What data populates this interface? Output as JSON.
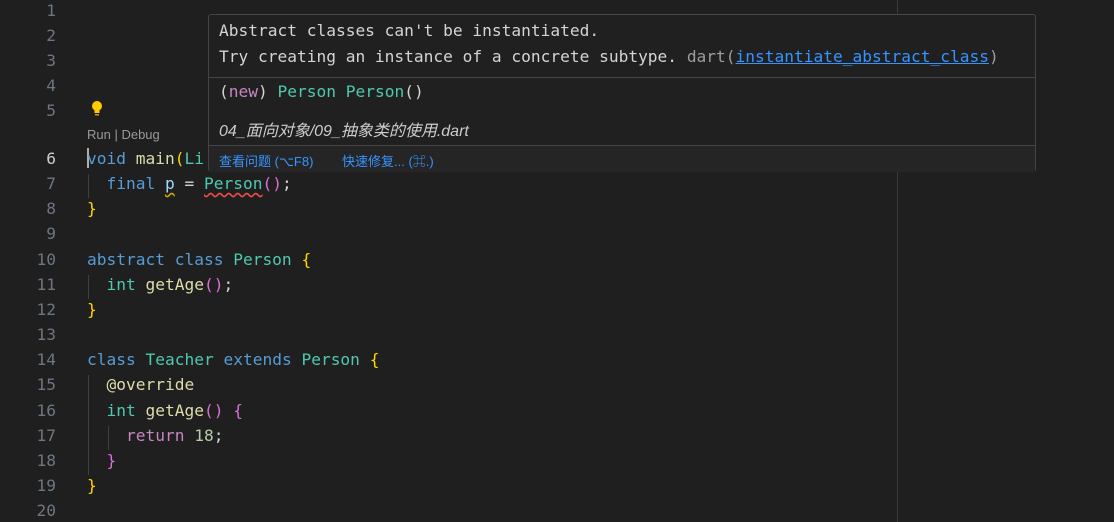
{
  "editor": {
    "line_numbers": [
      "1",
      "2",
      "3",
      "4",
      "5",
      "6",
      "7",
      "8",
      "9",
      "10",
      "11",
      "12",
      "13",
      "14",
      "15",
      "16",
      "17",
      "18",
      "19",
      "20"
    ],
    "active_line": "6",
    "codelens": "Run | Debug",
    "code": {
      "l6": {
        "void": "void",
        "main": "main",
        "paren": "(",
        "rest": "Li"
      },
      "l7": {
        "final": "final",
        "p": "p",
        "eq": " = ",
        "person": "Person",
        "parens": "()",
        "semi": ";"
      },
      "l8": {
        "close": "}"
      },
      "l10": {
        "abstract": "abstract",
        "class": "class",
        "name": "Person",
        "open": "{"
      },
      "l11": {
        "int": "int",
        "method": "getAge",
        "parens": "()",
        "semi": ";"
      },
      "l12": {
        "close": "}"
      },
      "l14": {
        "class": "class",
        "name": "Teacher",
        "extends": "extends",
        "parent": "Person",
        "open": "{"
      },
      "l15": {
        "annotation": "@override"
      },
      "l16": {
        "int": "int",
        "method": "getAge",
        "parens": "()",
        "open": "{"
      },
      "l17": {
        "return": "return",
        "value": "18",
        "semi": ";"
      },
      "l18": {
        "close": "}"
      },
      "l19": {
        "close": "}"
      }
    }
  },
  "hover": {
    "message_line1": "Abstract classes can't be instantiated.",
    "message_line2": "Try creating an instance of a concrete subtype.",
    "source": "dart",
    "source_open": "(",
    "code_link": "instantiate_abstract_class",
    "source_close": ")",
    "sig_open": "(",
    "sig_new": "new",
    "sig_close": ")",
    "sig_type": "Person",
    "sig_name": "Person",
    "sig_parens": "()",
    "file": "04_面向对象/09_抽象类的使用.dart",
    "action_view_problem": "查看问题 (⌥F8)",
    "action_quick_fix": "快速修复... (⌘.)"
  },
  "colors": {
    "background": "#1f1f1f",
    "keyword": "#569cd6",
    "control": "#c586c0",
    "function": "#dcdcaa",
    "type": "#4ec9b0",
    "number": "#b5cea8",
    "link": "#3794ff",
    "error": "#f14c4c"
  },
  "icons": {
    "lightbulb": "lightbulb-icon"
  }
}
